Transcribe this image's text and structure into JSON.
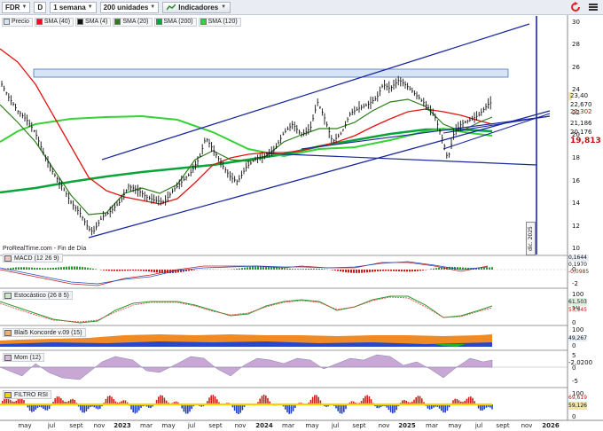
{
  "toolbar": {
    "ticker": "FDR",
    "timeframe_code": "D",
    "timeframe": "1 semana",
    "units": "200 unidades",
    "indicators": "Indicadores"
  },
  "legend": {
    "items": [
      {
        "label": "Precio",
        "color": "#d9e3f2"
      },
      {
        "label": "SMA (40)",
        "color": "#e01515"
      },
      {
        "label": "SMA (4)",
        "color": "#111111"
      },
      {
        "label": "SMA (20)",
        "color": "#2f7d1a"
      },
      {
        "label": "SMA (200)",
        "color": "#0aa53a"
      },
      {
        "label": "SMA (120)",
        "color": "#36d236"
      }
    ]
  },
  "source": "ProRealTime.com - Fin de Día",
  "price_axis": {
    "ticks": [
      "30",
      "28",
      "26",
      "24",
      "22",
      "20",
      "18",
      "16",
      "14",
      "12",
      "10"
    ],
    "tags": [
      {
        "label": "23,40",
        "bg": "#f2e7a0",
        "color": "#111111"
      },
      {
        "label": "22,670",
        "bg": "#ffffff",
        "color": "#111111"
      },
      {
        "label": "22,302",
        "bg": "#ffffff",
        "color": "#c01010"
      },
      {
        "label": "21,186",
        "bg": "#ffffff",
        "color": "#111111"
      },
      {
        "label": "20,176",
        "bg": "#ffffff",
        "color": "#111111"
      },
      {
        "label": "19,813",
        "bg": "#ffffff",
        "color": "#c01010"
      }
    ]
  },
  "year_marker": "dic. 2025",
  "panels": {
    "macd": {
      "label": "MACD (12 26 9)",
      "values": [
        "0,1644",
        "0,1970",
        "-0,0985"
      ],
      "ticks": [
        "0",
        "-2"
      ]
    },
    "stoch": {
      "label": "Estocástico (26 8 5)",
      "values": [
        "61,503",
        "53,945"
      ],
      "ticks": [
        "100",
        "50",
        "0"
      ]
    },
    "blai5": {
      "label": "Blai5 Koncorde v.09 (15)",
      "values": [
        "49,267"
      ],
      "ticks": [
        "100",
        "0"
      ]
    },
    "mom": {
      "label": "Mom (12)",
      "values": [
        "-2,0200"
      ],
      "ticks": [
        "5",
        "0",
        "-5"
      ]
    },
    "rsi": {
      "label": "FILTRO RSI",
      "values": [
        "69,619",
        "59,126"
      ],
      "ticks": [
        "100",
        "0"
      ]
    }
  },
  "x_axis": [
    {
      "label": "may",
      "bold": false
    },
    {
      "label": "jul",
      "bold": false
    },
    {
      "label": "sept",
      "bold": false
    },
    {
      "label": "nov",
      "bold": false
    },
    {
      "label": "2023",
      "bold": true
    },
    {
      "label": "mar",
      "bold": false
    },
    {
      "label": "may",
      "bold": false
    },
    {
      "label": "jul",
      "bold": false
    },
    {
      "label": "sept",
      "bold": false
    },
    {
      "label": "nov",
      "bold": false
    },
    {
      "label": "2024",
      "bold": true
    },
    {
      "label": "mar",
      "bold": false
    },
    {
      "label": "may",
      "bold": false
    },
    {
      "label": "jul",
      "bold": false
    },
    {
      "label": "sept",
      "bold": false
    },
    {
      "label": "nov",
      "bold": false
    },
    {
      "label": "2025",
      "bold": true
    },
    {
      "label": "mar",
      "bold": false
    },
    {
      "label": "may",
      "bold": false
    },
    {
      "label": "jul",
      "bold": false
    },
    {
      "label": "sept",
      "bold": false
    },
    {
      "label": "nov",
      "bold": false
    },
    {
      "label": "2026",
      "bold": true
    }
  ]
}
